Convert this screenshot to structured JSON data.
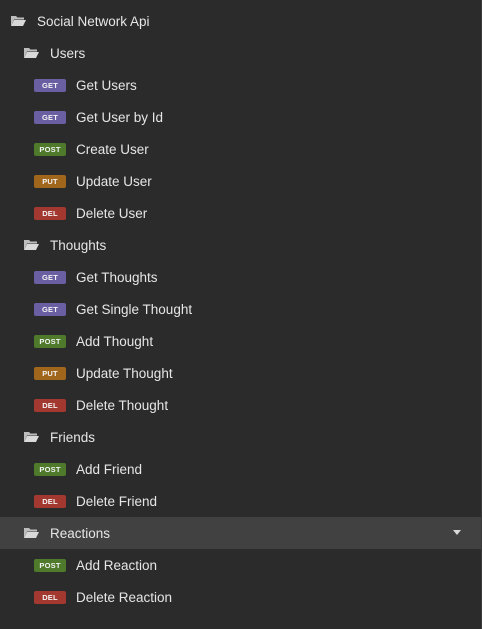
{
  "root": {
    "label": "Social Network Api",
    "icon": "folder-open-icon"
  },
  "folders": [
    {
      "label": "Users",
      "requests": [
        {
          "method": "GET",
          "label": "Get Users"
        },
        {
          "method": "GET",
          "label": "Get User by Id"
        },
        {
          "method": "POST",
          "label": "Create User"
        },
        {
          "method": "PUT",
          "label": "Update User"
        },
        {
          "method": "DEL",
          "label": "Delete User"
        }
      ]
    },
    {
      "label": "Thoughts",
      "requests": [
        {
          "method": "GET",
          "label": "Get Thoughts"
        },
        {
          "method": "GET",
          "label": "Get Single Thought"
        },
        {
          "method": "POST",
          "label": "Add Thought"
        },
        {
          "method": "PUT",
          "label": "Update Thought"
        },
        {
          "method": "DEL",
          "label": "Delete Thought"
        }
      ]
    },
    {
      "label": "Friends",
      "requests": [
        {
          "method": "POST",
          "label": "Add Friend"
        },
        {
          "method": "DEL",
          "label": "Delete Friend"
        }
      ]
    },
    {
      "label": "Reactions",
      "active": true,
      "requests": [
        {
          "method": "POST",
          "label": "Add Reaction"
        },
        {
          "method": "DEL",
          "label": "Delete Reaction"
        }
      ]
    }
  ],
  "colors": {
    "background": "#2b2b2b",
    "active_row": "#414141",
    "get": "#6b5fa3",
    "post": "#4f7a2b",
    "put": "#a0661c",
    "del": "#a2382f"
  }
}
